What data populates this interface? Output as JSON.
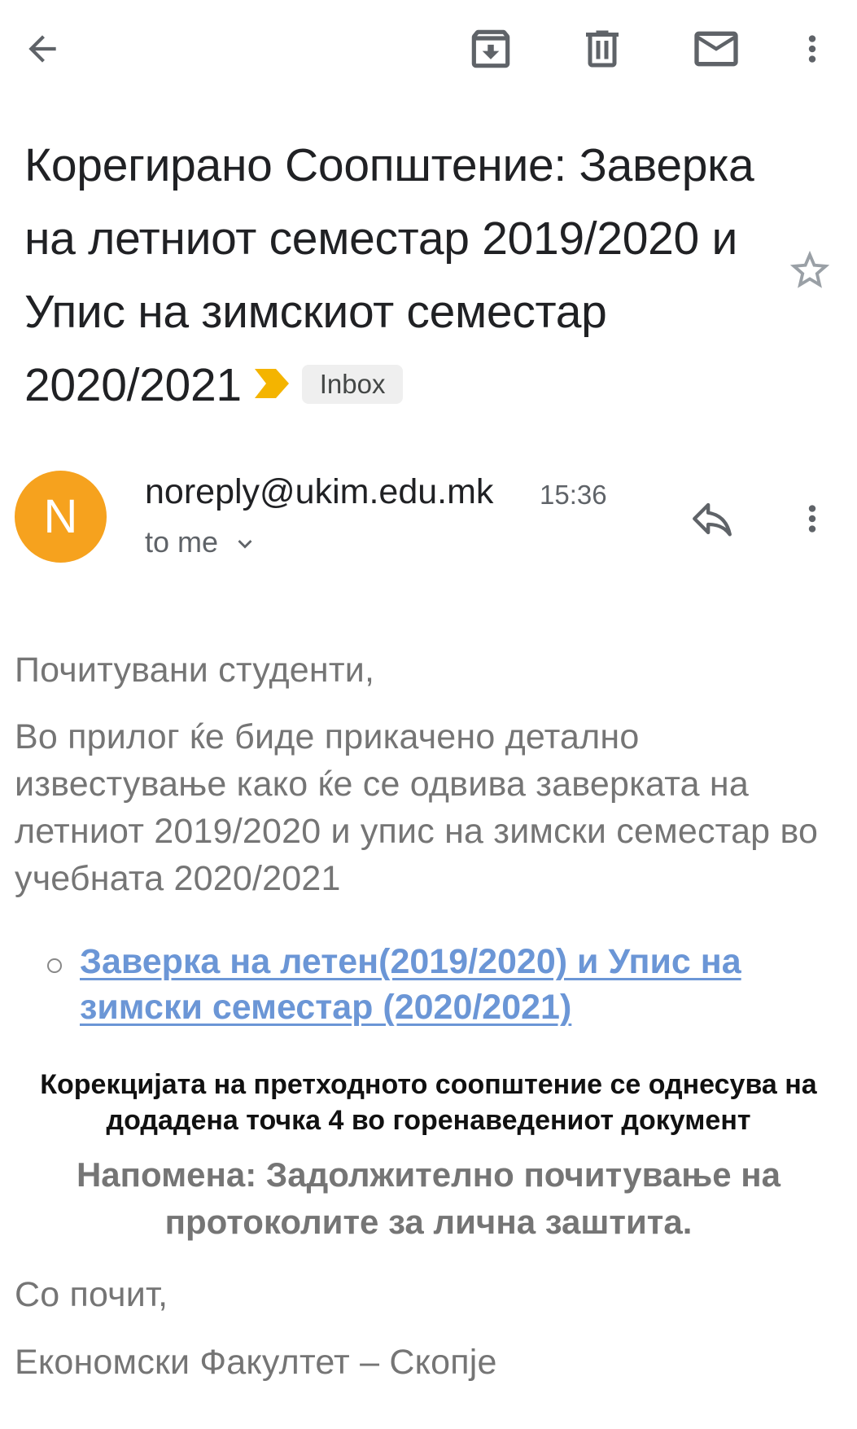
{
  "toolbar": {
    "icons": [
      "back-arrow-icon",
      "archive-icon",
      "delete-icon",
      "mark-unread-icon",
      "more-vert-icon"
    ]
  },
  "email": {
    "subject": "Корегирано Соопштение: Заверка на летниот семестар 2019/2020 и Упис на зимскиот семестар 2020/2021",
    "label": "Inbox",
    "importance_color": "#f4b400",
    "sender": {
      "avatar_letter": "N",
      "avatar_color": "#f6a21e",
      "address": "noreply@ukim.edu.mk",
      "time": "15:36",
      "recipient": "to me"
    },
    "body": {
      "greeting": "Почитувани студенти,",
      "intro": "Во прилог ќе биде прикачено детално известување како ќе се одвива заверката на летниот 2019/2020 и упис на зимски семестар во учебната 2020/2021",
      "attachment_link": "Заверка на летен(2019/2020) и Упис на зимски семестар (2020/2021)",
      "correction": "Корекцијата на претходното соопштение се однесува на додадена точка 4 во горенаведениот документ",
      "note": "Напомена: Задолжително почитување на протоколите за лична заштита.",
      "closing": "Со почит,",
      "signature": "Економски Факултет – Скопје"
    }
  }
}
